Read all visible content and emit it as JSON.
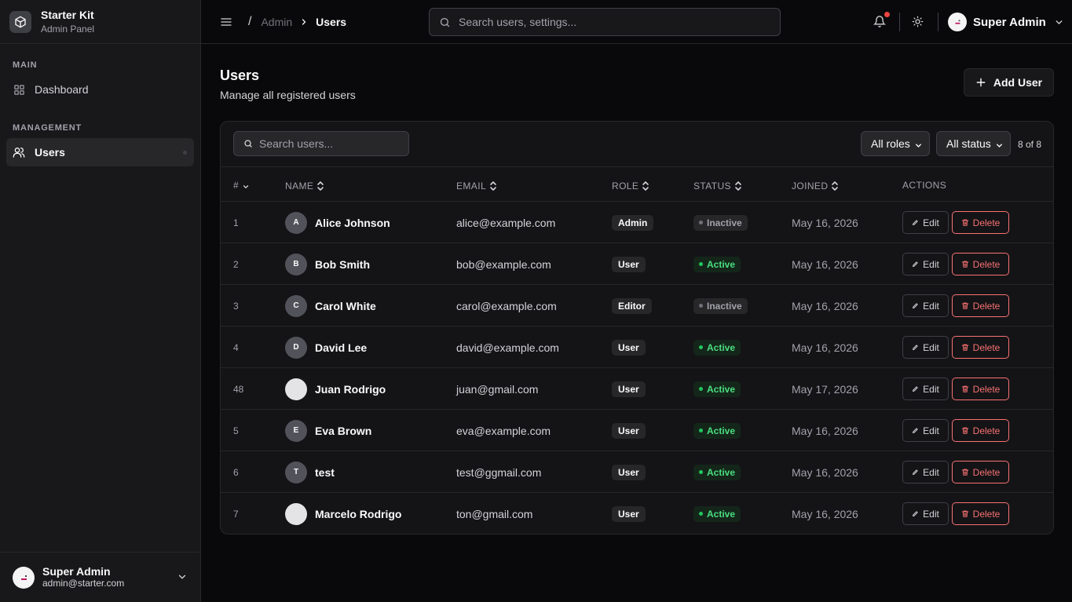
{
  "sidebar": {
    "brand_title": "Starter Kit",
    "brand_subtitle": "Admin Panel",
    "section_main": "MAIN",
    "dashboard_label": "Dashboard",
    "section_management": "MANAGEMENT",
    "users_label": "Users",
    "footer_name": "Super Admin",
    "footer_email": "admin@starter.com"
  },
  "header": {
    "breadcrumb_admin": "Admin",
    "breadcrumb_current": "Users",
    "search_placeholder": "Search users, settings...",
    "user_name": "Super Admin"
  },
  "page": {
    "title": "Users",
    "subtitle": "Manage all registered users",
    "add_label": "Add User"
  },
  "table": {
    "search_placeholder": "Search users...",
    "role_filter": "All roles",
    "status_filter": "All status",
    "count": "8 of 8",
    "columns": {
      "num": "#",
      "name": "NAME",
      "email": "EMAIL",
      "role": "ROLE",
      "status": "STATUS",
      "joined": "JOINED",
      "actions": "ACTIONS"
    },
    "edit_label": "Edit",
    "delete_label": "Delete",
    "rows": [
      {
        "id": "1",
        "initial": "A",
        "name": "Alice Johnson",
        "email": "alice@example.com",
        "role": "Admin",
        "status": "Inactive",
        "joined": "May 16, 2026"
      },
      {
        "id": "2",
        "initial": "B",
        "name": "Bob Smith",
        "email": "bob@example.com",
        "role": "User",
        "status": "Active",
        "joined": "May 16, 2026"
      },
      {
        "id": "3",
        "initial": "C",
        "name": "Carol White",
        "email": "carol@example.com",
        "role": "Editor",
        "status": "Inactive",
        "joined": "May 16, 2026"
      },
      {
        "id": "4",
        "initial": "D",
        "name": "David Lee",
        "email": "david@example.com",
        "role": "User",
        "status": "Active",
        "joined": "May 16, 2026"
      },
      {
        "id": "48",
        "initial": "",
        "name": "Juan Rodrigo",
        "email": "juan@gmail.com",
        "role": "User",
        "status": "Active",
        "joined": "May 17, 2026"
      },
      {
        "id": "5",
        "initial": "E",
        "name": "Eva Brown",
        "email": "eva@example.com",
        "role": "User",
        "status": "Active",
        "joined": "May 16, 2026"
      },
      {
        "id": "6",
        "initial": "T",
        "name": "test",
        "email": "test@ggmail.com",
        "role": "User",
        "status": "Active",
        "joined": "May 16, 2026"
      },
      {
        "id": "7",
        "initial": "",
        "name": "Marcelo Rodrigo",
        "email": "ton@gmail.com",
        "role": "User",
        "status": "Active",
        "joined": "May 16, 2026"
      }
    ]
  },
  "colors": {
    "background": "#09090b",
    "surface": "#18181b",
    "border": "#27272a",
    "active_green": "#4ade80",
    "danger_red": "#f87171",
    "notification_red": "#ef4444"
  }
}
